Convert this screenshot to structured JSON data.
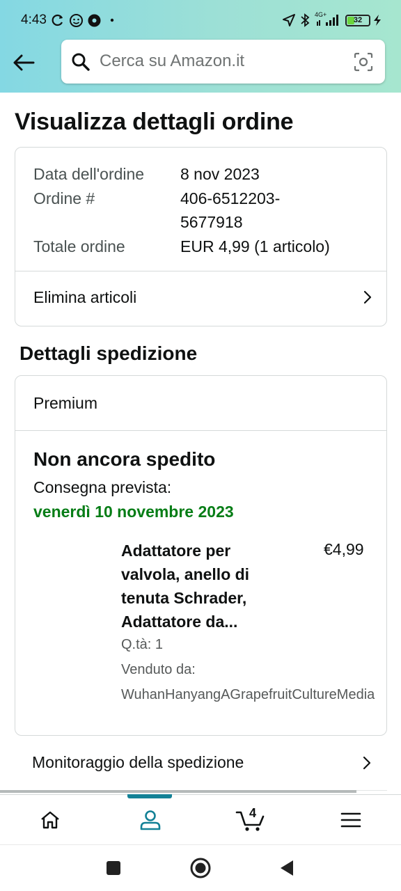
{
  "status_bar": {
    "time": "4:43",
    "network": "4G+",
    "battery": "32",
    "battery_color": "#6bd53c"
  },
  "header": {
    "back_icon": "arrow-left-icon",
    "search_placeholder": "Cerca su Amazon.it",
    "camera_icon": "camera-scan-icon"
  },
  "page": {
    "title": "Visualizza dettagli ordine"
  },
  "order_summary": {
    "date_label": "Data dell'ordine",
    "date_value": "8 nov 2023",
    "order_label": "Ordine #",
    "order_value_line1": "406-6512203-",
    "order_value_line2": "5677918",
    "total_label": "Totale ordine",
    "total_value": "EUR 4,99 (1 articolo)",
    "delete_items_label": "Elimina articoli"
  },
  "shipping": {
    "section_title": "Dettagli spedizione",
    "shipping_type": "Premium",
    "status": "Non ancora spedito",
    "delivery_label": "Consegna prevista:",
    "delivery_date": "venerdì 10 novembre 2023",
    "delivery_color": "#067d16",
    "item": {
      "title_line1": "Adattatore per",
      "title_line2": "valvola, anello di",
      "title_line3": "tenuta Schrader,",
      "title_line4": "Adattatore da...",
      "price": "€4,99",
      "quantity": "Q.tà: 1",
      "sold_by_label": "Venduto da:",
      "seller": "WuhanHanyangAGrapefruitCultureMedia"
    },
    "tracking_label": "Monitoraggio della spedizione"
  },
  "bottom_nav": {
    "items": [
      "home-icon",
      "account-icon",
      "cart-icon",
      "menu-icon"
    ],
    "active": "account-icon",
    "accent_color": "#138196",
    "cart_count": "4"
  },
  "system_nav": {
    "items": [
      "recents-square-icon",
      "home-circle-icon",
      "back-triangle-icon"
    ]
  }
}
